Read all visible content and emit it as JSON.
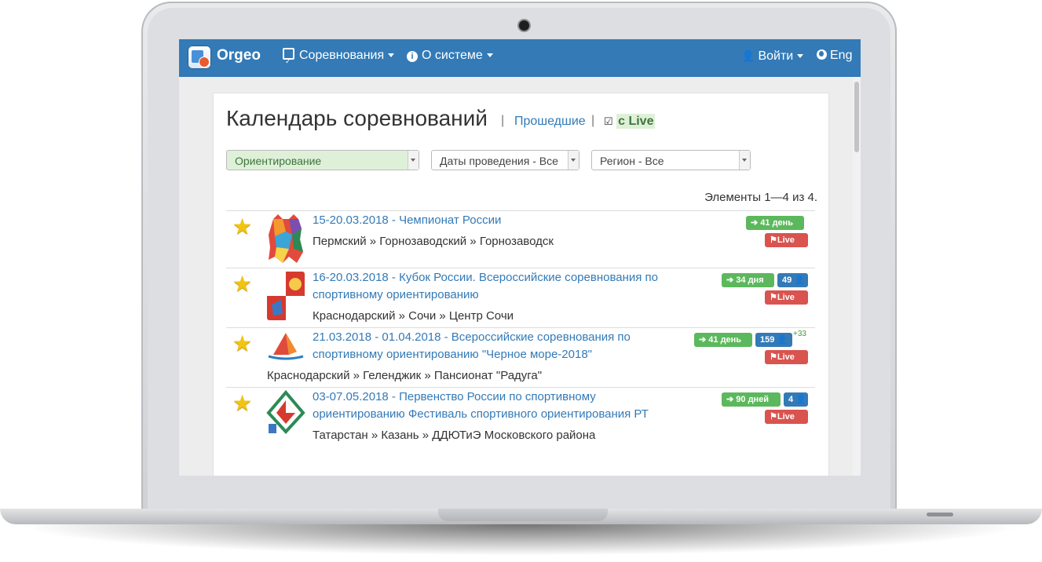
{
  "navbar": {
    "brand": "Orgeo",
    "competitions": "Соревнования",
    "about": "О системе",
    "login": "Войти",
    "language": "Eng"
  },
  "page": {
    "title": "Календарь соревнований",
    "separator": "|",
    "past_link": "Прошедшие",
    "live_checkbox": "☑",
    "live_label": "c Live"
  },
  "filters": {
    "sport": "Ориентирование",
    "dates": "Даты проведения - Все",
    "region": "Регион - Все"
  },
  "summary": "Элементы 1—4 из 4.",
  "events": [
    {
      "title": "15-20.03.2018 - Чемпионат России",
      "place": "Пермский » Горнозаводский » Горнозаводск",
      "entry_badge": "➔ 41 день",
      "live_badge": "⚑Live"
    },
    {
      "title": "16-20.03.2018 - Кубок России. Всероссийские соревнования по спортивному ориентированию",
      "place": "Краснодарский » Сочи » Центр Сочи",
      "entry_badge": "➔ 34 дня",
      "participants_badge": "49 👤",
      "live_badge": "⚑Live"
    },
    {
      "title": "21.03.2018 - 01.04.2018 - Всероссийские соревнования по спортивному ориентированию \"Черное море-2018\"",
      "place": "Краснодарский » Геленджик » Пансионат \"Радуга\"",
      "entry_badge": "➔ 41 день",
      "participants_badge": "159 👤",
      "participants_delta": "+33",
      "live_badge": "⚑Live"
    },
    {
      "title": "03-07.05.2018 - Первенство России по спортивному ориентированию Фестиваль спортивного ориентирования РТ",
      "place": "Татарстан » Казань » ДДЮТиЭ Московского района",
      "entry_badge": "➔ 90 дней",
      "participants_badge": "4 👤",
      "live_badge": "⚑Live"
    }
  ],
  "colors": {
    "navbar": "#337ab7",
    "link": "#337ab7",
    "badge_green": "#5cb85c",
    "badge_blue": "#337ab7",
    "badge_red": "#d9534f",
    "star": "#f2c40f"
  }
}
